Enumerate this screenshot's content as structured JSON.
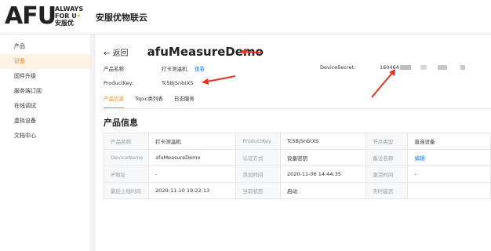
{
  "header": {
    "logo_text": "AFU",
    "logo_line1": "ALWAYS",
    "logo_line2": "FOR U",
    "logo_line3": "安服优",
    "app_title": "安服优物联云"
  },
  "sidebar": {
    "items": [
      {
        "label": "产品",
        "active": false
      },
      {
        "label": "设备",
        "active": true
      },
      {
        "label": "固件升级",
        "active": false
      },
      {
        "label": "服务端订阅",
        "active": false
      },
      {
        "label": "在线调试",
        "active": false
      },
      {
        "label": "虚拟设备",
        "active": false
      },
      {
        "label": "文档中心",
        "active": false
      }
    ]
  },
  "main": {
    "back_label": "← 返回",
    "device_name": "afuMeasureDemo",
    "product_name_label": "产品名称:",
    "product_name_value": "打卡测温机",
    "view_link": "查看",
    "device_secret_label": "DeviceSecret:",
    "device_secret_value": "160464",
    "product_key_label": "ProductKey:",
    "product_key_value": "Tc5BjSnbtXS",
    "tabs": [
      {
        "label": "产品信息",
        "active": true
      },
      {
        "label": "Topic类列表",
        "active": false
      },
      {
        "label": "日志服务",
        "active": false
      }
    ],
    "section_title": "产品信息",
    "table": {
      "rows": [
        [
          [
            "产品名称",
            "打卡测温机"
          ],
          [
            "ProductKey",
            "Tc5BjSnbtXS"
          ],
          [
            "节点类型",
            "直连设备"
          ]
        ],
        [
          [
            "DeviceName",
            "afuMeasureDemo"
          ],
          [
            "认证方式",
            "设备密钥"
          ],
          [
            "备注名称",
            "编辑"
          ]
        ],
        [
          [
            "IP地址",
            "-"
          ],
          [
            "添加时间",
            "2020-11-06 14:44:35"
          ],
          [
            "激活时间",
            "-"
          ]
        ],
        [
          [
            "最后上线时间",
            "2020-11-10 19:22:13"
          ],
          [
            "当前状态",
            "启动"
          ],
          [
            "实时延迟",
            ""
          ]
        ]
      ]
    }
  },
  "colors": {
    "accent": "#f08c24",
    "link": "#1677ff",
    "annotation_arrow": "#e8321e"
  }
}
